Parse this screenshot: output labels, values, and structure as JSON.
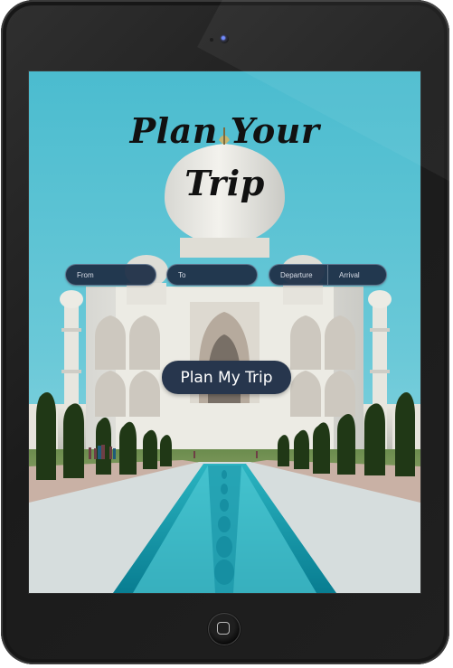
{
  "page": {
    "title_line_1": "Plan Your",
    "title_line_2": "Trip"
  },
  "search_bar": {
    "from_placeholder": "From",
    "to_placeholder": "To",
    "departure_placeholder": "Departure",
    "arrival_placeholder": "Arrival"
  },
  "actions": {
    "plan_button_label": "Plan My Trip"
  },
  "device": {
    "frame_color": "#242424",
    "camera_color": "#6b86ff"
  },
  "icons": {
    "camera": "camera-icon",
    "home": "home-button-icon"
  },
  "colors": {
    "sky": "#52bfd3",
    "button": "#27364d",
    "field": "#1e2f46"
  }
}
